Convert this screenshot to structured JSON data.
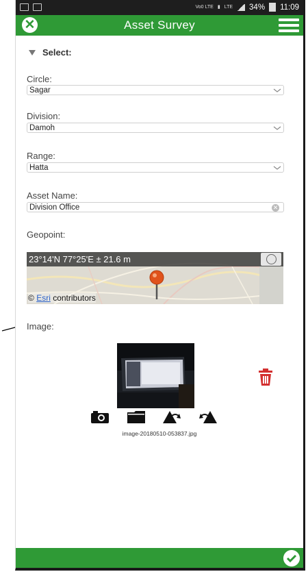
{
  "status_bar": {
    "icons_left": [
      "image-icon",
      "mail-icon"
    ],
    "volte": "Vo0 LTE",
    "lte": "LTE",
    "battery": "34%",
    "time": "11:09"
  },
  "app_bar": {
    "title": "Asset Survey",
    "close_icon": "close-circle-icon",
    "menu_icon": "hamburger-menu-icon",
    "accent": "#2f9a36"
  },
  "section": {
    "title": "Select:"
  },
  "fields": {
    "circle": {
      "label": "Circle:",
      "value": "Sagar"
    },
    "division": {
      "label": "Division:",
      "value": "Damoh"
    },
    "range": {
      "label": "Range:",
      "value": "Hatta"
    },
    "asset_name": {
      "label": "Asset Name:",
      "value": "Division Office"
    }
  },
  "geopoint": {
    "label": "Geopoint:",
    "coords": "23°14'N 77°25'E ± 21.6 m",
    "attribution_symbol": "©",
    "attribution_link": "Esri",
    "attribution_rest": " contributors"
  },
  "image": {
    "label": "Image:",
    "filename": "image-20180510-053837.jpg",
    "tools": [
      "camera-icon",
      "folder-icon",
      "rotate-left-icon",
      "rotate-right-icon"
    ],
    "delete_color": "#d32f2f"
  },
  "footer": {
    "submit_icon": "check-circle-icon"
  }
}
